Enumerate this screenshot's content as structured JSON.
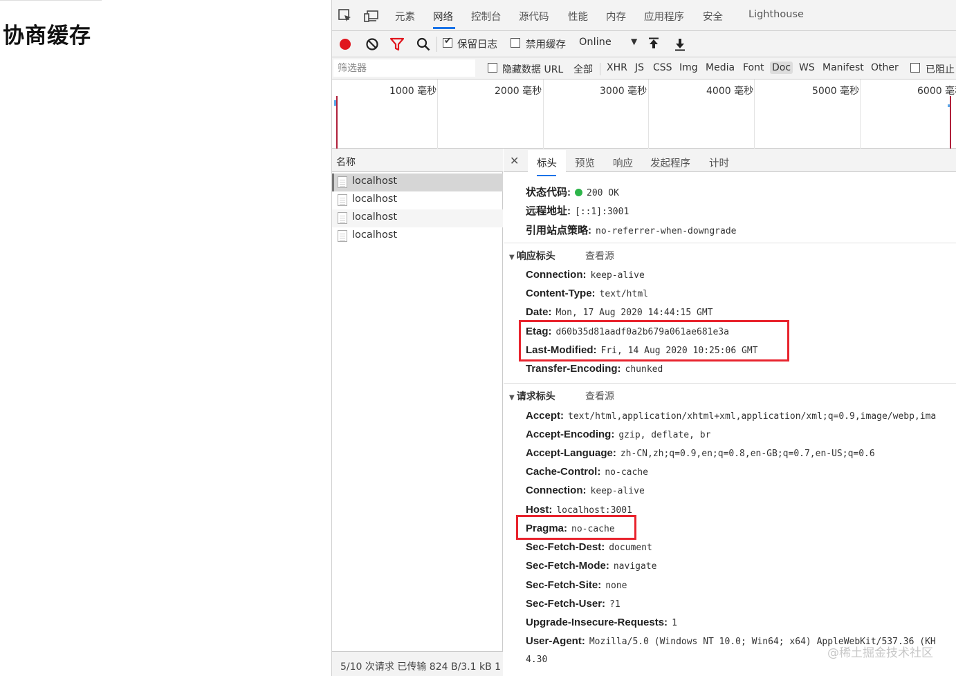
{
  "page": {
    "title": "协商缓存"
  },
  "devtools": {
    "main_tabs": [
      "元素",
      "网络",
      "控制台",
      "源代码",
      "性能",
      "内存",
      "应用程序",
      "安全",
      "Lighthouse"
    ],
    "active_main_tab": "网络",
    "toolbar": {
      "preserve_log_label": "保留日志",
      "preserve_log_checked": true,
      "disable_cache_label": "禁用缓存",
      "disable_cache_checked": false,
      "throttle_value": "Online"
    },
    "filter": {
      "placeholder": "筛选器",
      "hide_data_urls_label": "隐藏数据 URL",
      "types": [
        "全部",
        "XHR",
        "JS",
        "CSS",
        "Img",
        "Media",
        "Font",
        "Doc",
        "WS",
        "Manifest",
        "Other"
      ],
      "active_type": "Doc",
      "blocked_label": "已阻止"
    },
    "timeline": {
      "ticks": [
        "1000 毫秒",
        "2000 毫秒",
        "3000 毫秒",
        "4000 毫秒",
        "5000 毫秒",
        "6000 毫秒"
      ]
    },
    "request_list": {
      "header": "名称",
      "rows": [
        "localhost",
        "localhost",
        "localhost",
        "localhost"
      ],
      "status": "5/10 次请求  已传输 824 B/3.1 kB  1"
    },
    "detail": {
      "tabs": [
        "标头",
        "预览",
        "响应",
        "发起程序",
        "计时"
      ],
      "active_tab": "标头",
      "general": [
        {
          "key": "状态代码:",
          "value": "200 OK",
          "status_color": "#2db54a"
        },
        {
          "key": "远程地址:",
          "value": "[::1]:3001"
        },
        {
          "key": "引用站点策略:",
          "value": "no-referrer-when-downgrade"
        }
      ],
      "response_headers_title": "响应标头",
      "request_headers_title": "请求标头",
      "view_source_label": "查看源",
      "response_headers": [
        {
          "key": "Connection:",
          "value": "keep-alive"
        },
        {
          "key": "Content-Type:",
          "value": "text/html"
        },
        {
          "key": "Date:",
          "value": "Mon, 17 Aug 2020 14:44:15 GMT"
        },
        {
          "key": "Etag:",
          "value": "d60b35d81aadf0a2b679a061ae681e3a"
        },
        {
          "key": "Last-Modified:",
          "value": "Fri, 14 Aug 2020 10:25:06 GMT"
        },
        {
          "key": "Transfer-Encoding:",
          "value": "chunked"
        }
      ],
      "request_headers": [
        {
          "key": "Accept:",
          "value": "text/html,application/xhtml+xml,application/xml;q=0.9,image/webp,ima"
        },
        {
          "key": "Accept-Encoding:",
          "value": "gzip, deflate, br"
        },
        {
          "key": "Accept-Language:",
          "value": "zh-CN,zh;q=0.9,en;q=0.8,en-GB;q=0.7,en-US;q=0.6"
        },
        {
          "key": "Cache-Control:",
          "value": "no-cache"
        },
        {
          "key": "Connection:",
          "value": "keep-alive"
        },
        {
          "key": "Host:",
          "value": "localhost:3001"
        },
        {
          "key": "Pragma:",
          "value": "no-cache"
        },
        {
          "key": "Sec-Fetch-Dest:",
          "value": "document"
        },
        {
          "key": "Sec-Fetch-Mode:",
          "value": "navigate"
        },
        {
          "key": "Sec-Fetch-Site:",
          "value": "none"
        },
        {
          "key": "Sec-Fetch-User:",
          "value": "?1"
        },
        {
          "key": "Upgrade-Insecure-Requests:",
          "value": "1"
        },
        {
          "key": "User-Agent:",
          "value": "Mozilla/5.0 (Windows NT 10.0; Win64; x64) AppleWebKit/537.36 (KH"
        }
      ],
      "user_agent_continuation": "4.30"
    }
  },
  "watermark": "@稀土掘金技术社区",
  "colors": {
    "accent": "#1a73e8",
    "highlight": "#e8232d",
    "record": "#e0161e"
  }
}
